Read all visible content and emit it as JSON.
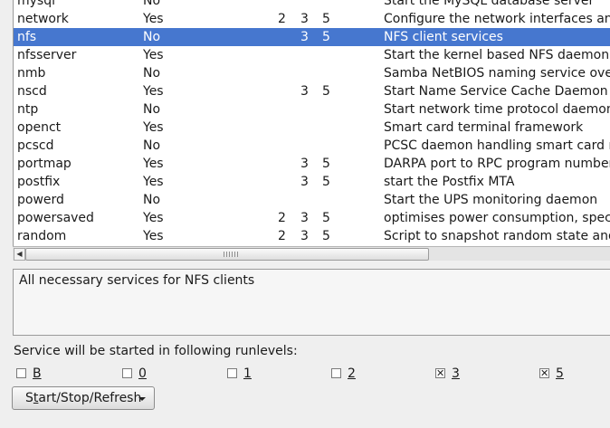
{
  "services": [
    {
      "name": "mysql",
      "enabled": "No",
      "r2": "",
      "r3": "",
      "r5": "",
      "description": "Start the MySQL database server"
    },
    {
      "name": "network",
      "enabled": "Yes",
      "r2": "2",
      "r3": "3",
      "r5": "5",
      "description": "Configure the network interfaces and s"
    },
    {
      "name": "nfs",
      "enabled": "No",
      "r2": "",
      "r3": "3",
      "r5": "5",
      "description": "NFS client services",
      "selected": true
    },
    {
      "name": "nfsserver",
      "enabled": "Yes",
      "r2": "",
      "r3": "",
      "r5": "",
      "description": "Start the kernel based NFS daemon"
    },
    {
      "name": "nmb",
      "enabled": "No",
      "r2": "",
      "r3": "",
      "r5": "",
      "description": "Samba NetBIOS naming service over I"
    },
    {
      "name": "nscd",
      "enabled": "Yes",
      "r2": "",
      "r3": "3",
      "r5": "5",
      "description": "Start Name Service Cache Daemon"
    },
    {
      "name": "ntp",
      "enabled": "No",
      "r2": "",
      "r3": "",
      "r5": "",
      "description": "Start network time protocol daemon (N"
    },
    {
      "name": "openct",
      "enabled": "Yes",
      "r2": "",
      "r3": "",
      "r5": "",
      "description": "Smart card terminal framework"
    },
    {
      "name": "pcscd",
      "enabled": "No",
      "r2": "",
      "r3": "",
      "r5": "",
      "description": "PCSC daemon handling smart card re"
    },
    {
      "name": "portmap",
      "enabled": "Yes",
      "r2": "",
      "r3": "3",
      "r5": "5",
      "description": "DARPA port to RPC program number r"
    },
    {
      "name": "postfix",
      "enabled": "Yes",
      "r2": "",
      "r3": "3",
      "r5": "5",
      "description": "start the Postfix MTA"
    },
    {
      "name": "powerd",
      "enabled": "No",
      "r2": "",
      "r3": "",
      "r5": "",
      "description": "Start the UPS monitoring daemon"
    },
    {
      "name": "powersaved",
      "enabled": "Yes",
      "r2": "2",
      "r3": "3",
      "r5": "5",
      "description": "optimises power consumption, speciall"
    },
    {
      "name": "random",
      "enabled": "Yes",
      "r2": "2",
      "r3": "3",
      "r5": "5",
      "description": "Script to snapshot random state and re"
    }
  ],
  "details": {
    "text": "All necessary services for NFS clients"
  },
  "runlevels": {
    "label": "Service will be started in following runlevels:",
    "items": [
      {
        "label": "B",
        "checked": false
      },
      {
        "label": "0",
        "checked": false
      },
      {
        "label": "1",
        "checked": false
      },
      {
        "label": "2",
        "checked": false
      },
      {
        "label": "3",
        "checked": true
      },
      {
        "label": "5",
        "checked": true
      }
    ]
  },
  "action_button": {
    "label_prefix": "S",
    "label_mnemonic": "t",
    "label_suffix": "art/Stop/Refresh"
  },
  "colors": {
    "selection": "#4677cf"
  }
}
